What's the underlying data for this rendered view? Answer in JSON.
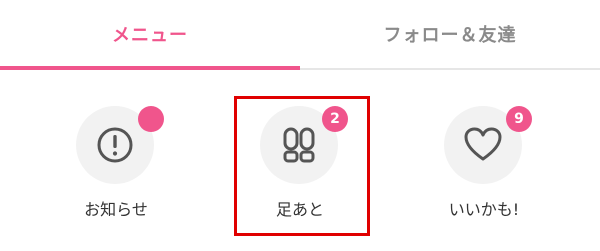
{
  "tabs": [
    {
      "label": "メニュー",
      "active": true
    },
    {
      "label": "フォロー＆友達",
      "active": false
    }
  ],
  "items": [
    {
      "label": "お知らせ",
      "icon": "exclamation-icon",
      "badge": ""
    },
    {
      "label": "足あと",
      "icon": "footprints-icon",
      "badge": "2"
    },
    {
      "label": "いいかも!",
      "icon": "heart-icon",
      "badge": "9"
    }
  ],
  "colors": {
    "accent": "#f0558c",
    "highlight": "#e00000",
    "muted": "#8a8a8a"
  }
}
